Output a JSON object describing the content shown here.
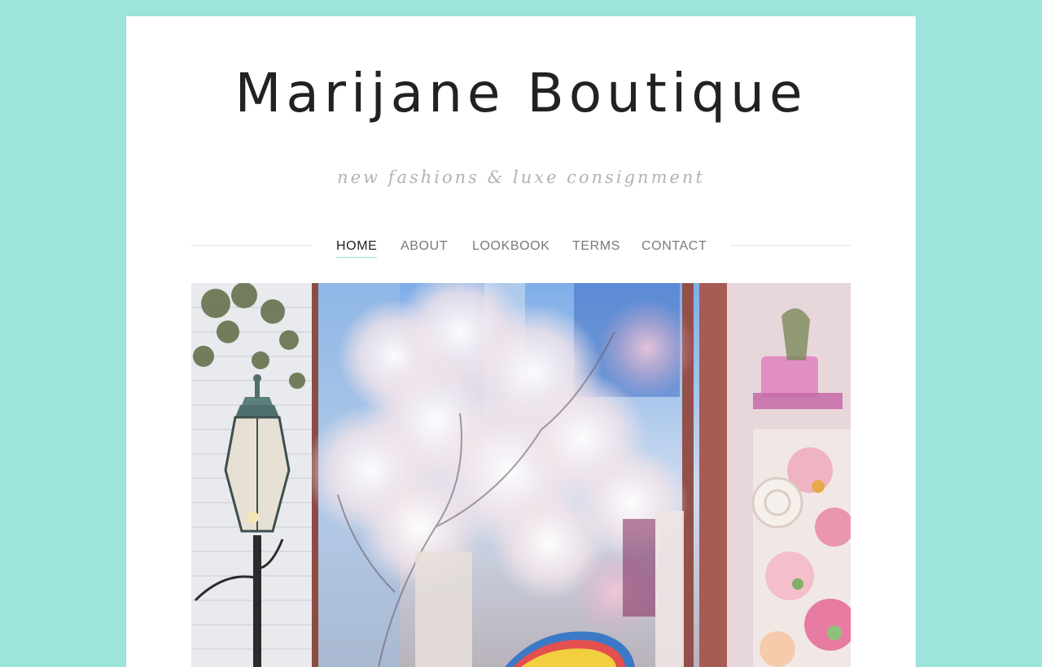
{
  "site": {
    "title": "Marijane Boutique",
    "tagline": "new fashions & luxe consignment"
  },
  "nav": {
    "items": [
      {
        "label": "HOME",
        "active": true
      },
      {
        "label": "ABOUT",
        "active": false
      },
      {
        "label": "LOOKBOOK",
        "active": false
      },
      {
        "label": "TERMS",
        "active": false
      },
      {
        "label": "CONTACT",
        "active": false
      }
    ]
  },
  "colors": {
    "background": "#9de5dc",
    "card": "#ffffff",
    "title": "#222222",
    "tagline": "#b3b3b3",
    "nav_text": "#7a7a7a",
    "nav_active": "#222222",
    "rule": "#e3e3e3"
  }
}
